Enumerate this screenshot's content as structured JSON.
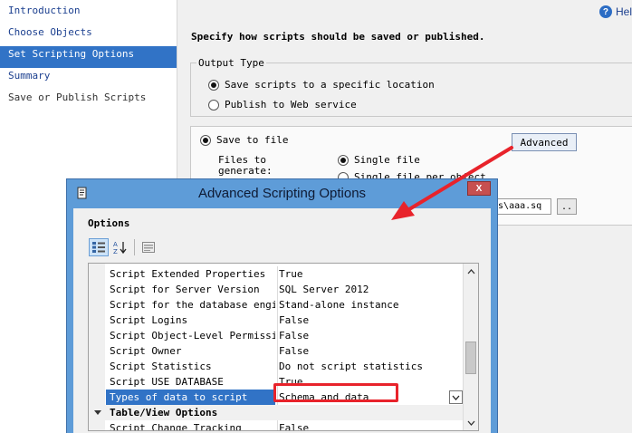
{
  "nav": {
    "items": [
      {
        "label": "Introduction",
        "state": "link"
      },
      {
        "label": "Choose Objects",
        "state": "link"
      },
      {
        "label": "Set Scripting Options",
        "state": "selected"
      },
      {
        "label": "Summary",
        "state": "link"
      },
      {
        "label": "Save or Publish Scripts",
        "state": "muted"
      }
    ]
  },
  "content": {
    "help_label": "Hel",
    "heading": "Specify how scripts should be saved or published.",
    "output_type": {
      "legend": "Output Type",
      "option_save": "Save scripts to a specific location",
      "option_publish": "Publish to Web service"
    },
    "save_to_file": "Save to file",
    "advanced_label": "Advanced",
    "files_to_generate_line1": "Files to",
    "files_to_generate_line2": "generate:",
    "single_file": "Single file",
    "single_file_per_object": "Single file per object",
    "path_value": "ads\\aaa.sq",
    "browse_label": ".."
  },
  "dialog": {
    "title": "Advanced Scripting Options",
    "close_label": "X",
    "options_label": "Options",
    "rows": [
      {
        "name": "Script Extended Properties",
        "value": "True"
      },
      {
        "name": "Script for Server Version",
        "value": "SQL Server 2012"
      },
      {
        "name": "Script for the database engine",
        "value": "Stand-alone instance"
      },
      {
        "name": "Script Logins",
        "value": "False"
      },
      {
        "name": "Script Object-Level Permissions",
        "value": "False"
      },
      {
        "name": "Script Owner",
        "value": "False"
      },
      {
        "name": "Script Statistics",
        "value": "Do not script statistics"
      },
      {
        "name": "Script USE DATABASE",
        "value": "True"
      }
    ],
    "selected_row": {
      "name": "Types of data to script",
      "value": "Schema and data"
    },
    "category": "Table/View Options",
    "last_row": {
      "name": "Script Change Tracking",
      "value": "False"
    }
  },
  "colors": {
    "selection_blue": "#3173c6",
    "annotation_red": "#e8232b",
    "dialog_frame": "#5e9cd8"
  }
}
